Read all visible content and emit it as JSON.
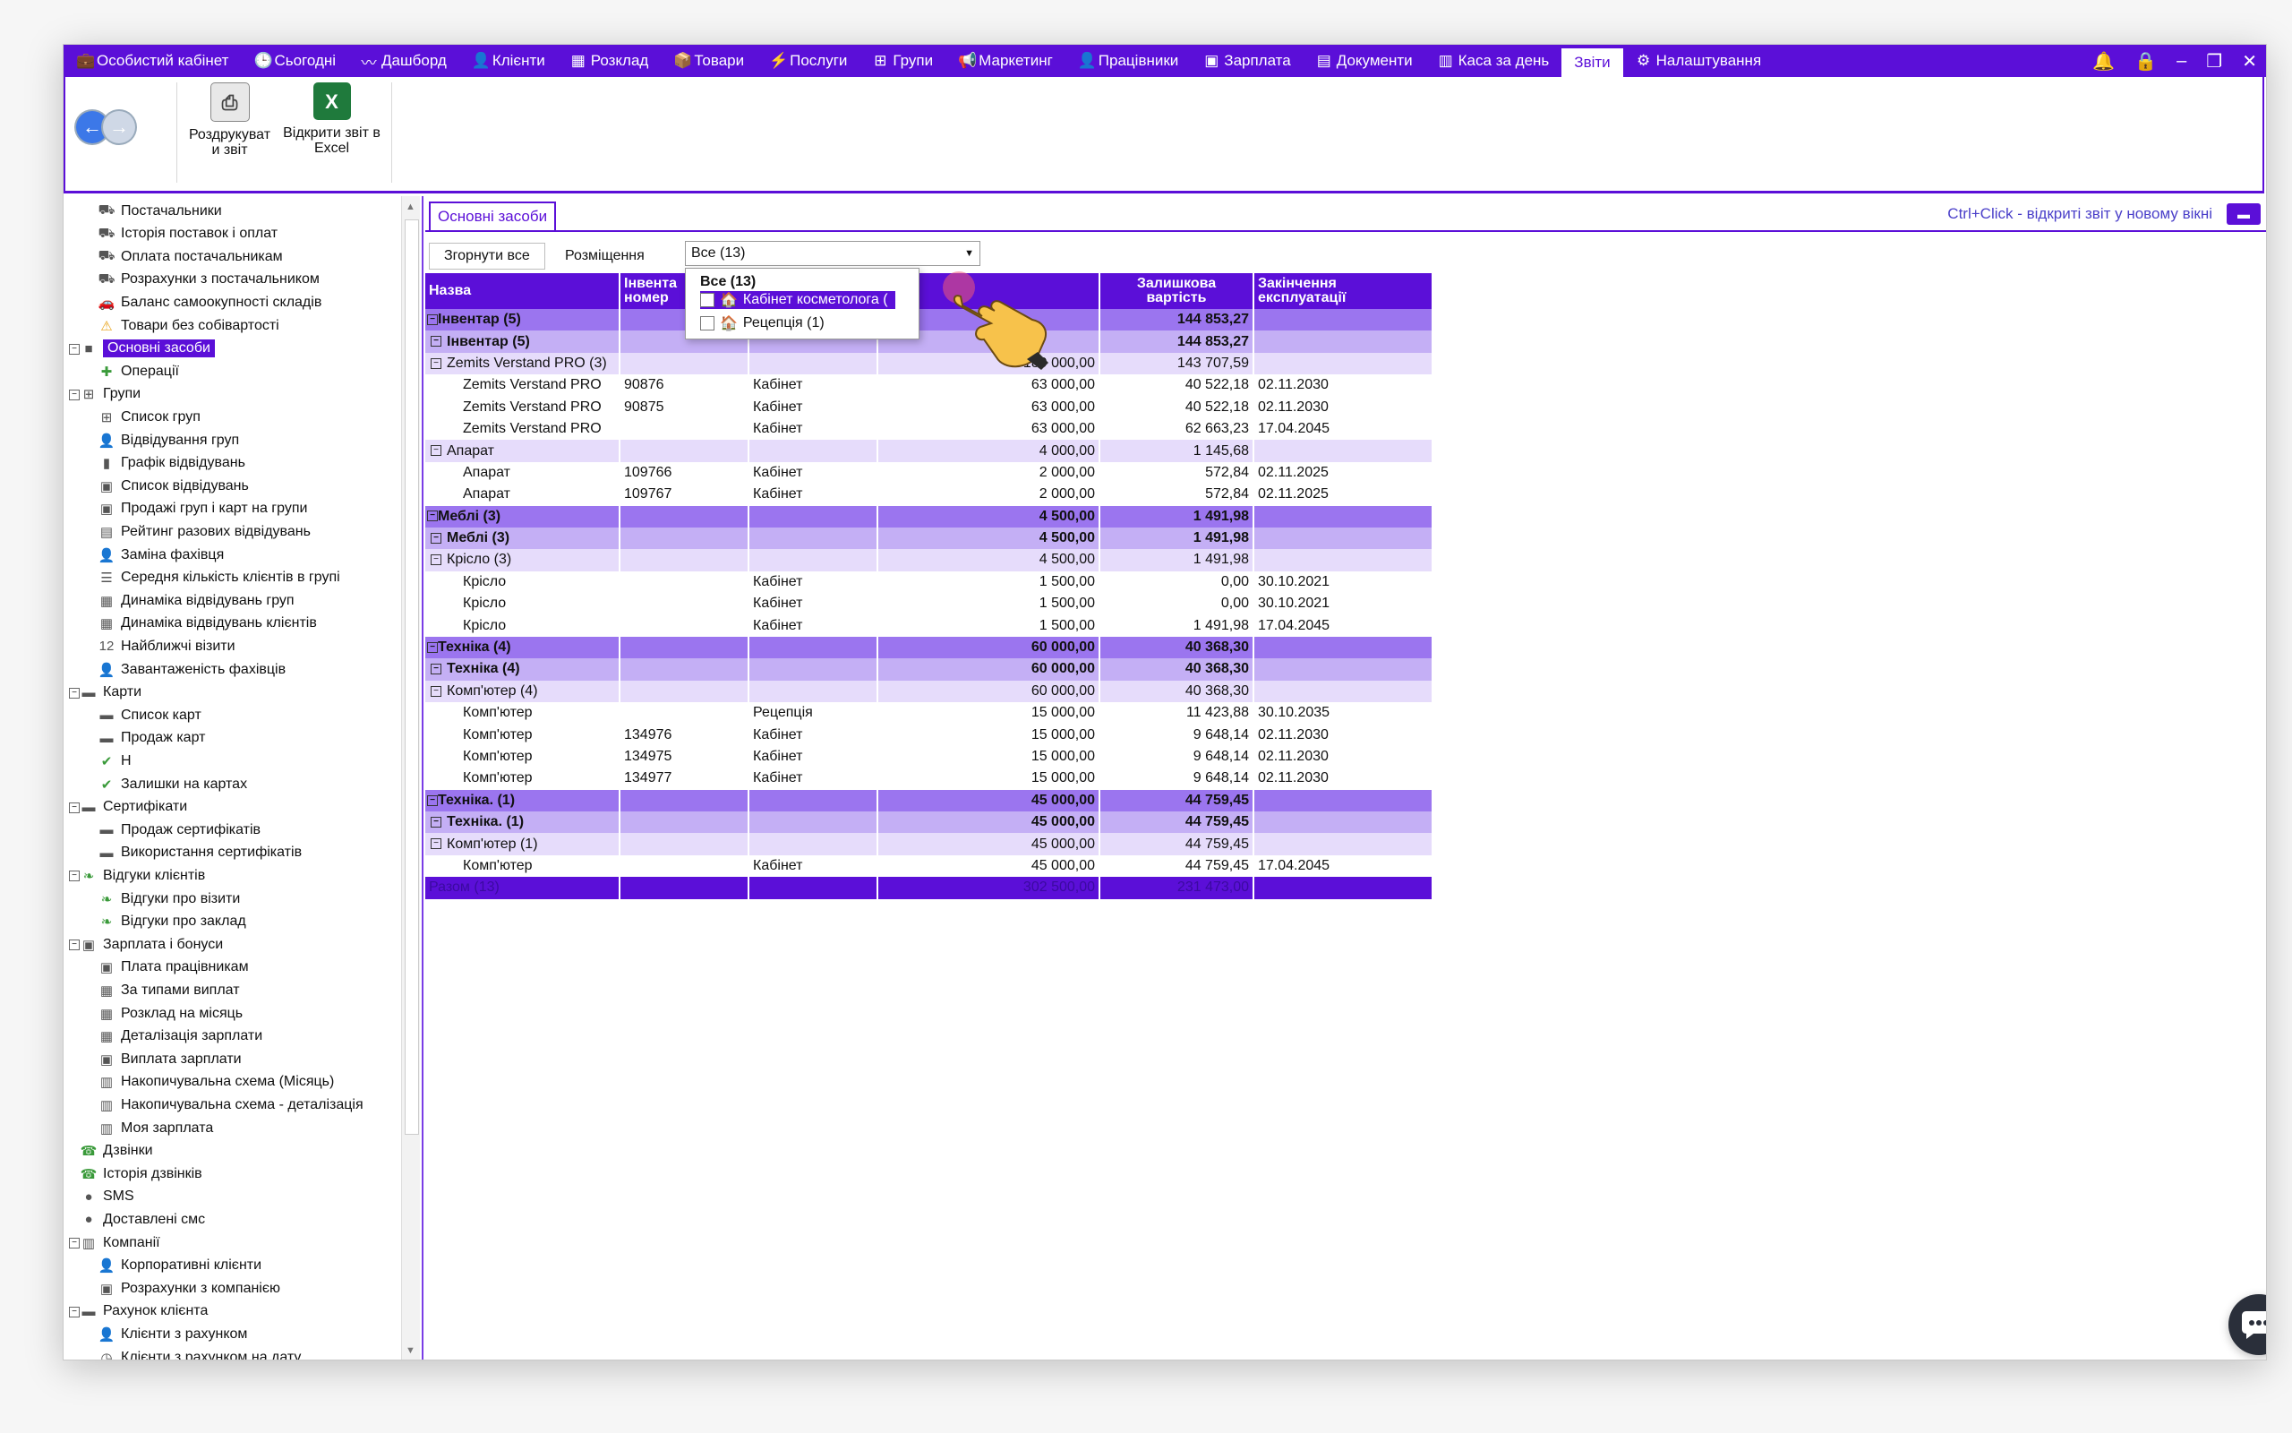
{
  "menu": [
    {
      "label": "Особистий кабінет",
      "icon": "briefcase-icon",
      "glyph": "💼"
    },
    {
      "label": "Сьогодні",
      "icon": "clock-icon",
      "glyph": "🕒"
    },
    {
      "label": "Дашборд",
      "icon": "pulse-icon",
      "glyph": "〰"
    },
    {
      "label": "Клієнти",
      "icon": "user-circle-icon",
      "glyph": "👤"
    },
    {
      "label": "Розклад",
      "icon": "calendar-icon",
      "glyph": "▦"
    },
    {
      "label": "Товари",
      "icon": "box-icon",
      "glyph": "📦"
    },
    {
      "label": "Послуги",
      "icon": "bolt-icon",
      "glyph": "⚡"
    },
    {
      "label": "Групи",
      "icon": "group-icon",
      "glyph": "⊞"
    },
    {
      "label": "Маркетинг",
      "icon": "megaphone-icon",
      "glyph": "📢"
    },
    {
      "label": "Працівники",
      "icon": "person-icon",
      "glyph": "👤"
    },
    {
      "label": "Зарплата",
      "icon": "money-icon",
      "glyph": "▣"
    },
    {
      "label": "Документи",
      "icon": "document-icon",
      "glyph": "▤"
    },
    {
      "label": "Каса за день",
      "icon": "calculator-icon",
      "glyph": "▥"
    },
    {
      "label": "Звіти",
      "icon": "",
      "glyph": ""
    },
    {
      "label": "Налаштування",
      "icon": "gear-icon",
      "glyph": "⚙"
    }
  ],
  "ribbon": {
    "print_label_1": "Роздрукуват",
    "print_label_2": "и звіт",
    "excel_label_1": "Відкрити звіт в",
    "excel_label_2": "Excel"
  },
  "tree": [
    {
      "label": "Постачальники",
      "level": 1,
      "icon": "suppliers-icon",
      "glyph": "⛟"
    },
    {
      "label": "Історія поставок і оплат",
      "level": 1,
      "icon": "suppliers-icon",
      "glyph": "⛟"
    },
    {
      "label": "Оплата постачальникам",
      "level": 1,
      "icon": "suppliers-icon",
      "glyph": "⛟"
    },
    {
      "label": "Розрахунки з постачальником",
      "level": 1,
      "icon": "suppliers-icon",
      "glyph": "⛟"
    },
    {
      "label": "Баланс самоокупності складів",
      "level": 1,
      "icon": "car-icon",
      "glyph": "🚗"
    },
    {
      "label": "Товари без собівартості",
      "level": 1,
      "icon": "warning-icon",
      "glyph": "⚠"
    },
    {
      "label": "Основні засоби",
      "level": 0,
      "icon": "assets-icon",
      "glyph": "■",
      "selected": true,
      "toggle": "−"
    },
    {
      "label": "Операції",
      "level": 1,
      "icon": "operations-icon",
      "glyph": "✚"
    },
    {
      "label": "Групи",
      "level": 0,
      "icon": "group-icon",
      "glyph": "⊞",
      "toggle": "−"
    },
    {
      "label": "Список груп",
      "level": 1,
      "icon": "group-icon",
      "glyph": "⊞"
    },
    {
      "label": "Відвідування груп",
      "level": 1,
      "icon": "person-icon",
      "glyph": "👤"
    },
    {
      "label": "Графік відвідувань",
      "level": 1,
      "icon": "bar-chart-icon",
      "glyph": "▮"
    },
    {
      "label": "Список відвідувань",
      "level": 1,
      "icon": "money-icon",
      "glyph": "▣"
    },
    {
      "label": "Продажі груп і карт на групи",
      "level": 1,
      "icon": "money-icon",
      "glyph": "▣"
    },
    {
      "label": "Рейтинг разових відвідувань",
      "level": 1,
      "icon": "rating-icon",
      "glyph": "▤"
    },
    {
      "label": "Заміна фахівця",
      "level": 1,
      "icon": "person-icon",
      "glyph": "👤"
    },
    {
      "label": "Середня кількість клієнтів в групі",
      "level": 1,
      "icon": "list-icon",
      "glyph": "☰"
    },
    {
      "label": "Динаміка відвідувань груп",
      "level": 1,
      "icon": "grid-icon",
      "glyph": "▦"
    },
    {
      "label": "Динаміка відвідувань клієнтів",
      "level": 1,
      "icon": "grid-icon",
      "glyph": "▦"
    },
    {
      "label": "Найближчі візити",
      "level": 1,
      "icon": "calendar-12-icon",
      "glyph": "12"
    },
    {
      "label": "Завантаженість фахівців",
      "level": 1,
      "icon": "person-icon",
      "glyph": "👤"
    },
    {
      "label": "Карти",
      "level": 0,
      "icon": "cards-icon",
      "glyph": "▬",
      "toggle": "−"
    },
    {
      "label": "Список карт",
      "level": 1,
      "icon": "cards-icon",
      "glyph": "▬"
    },
    {
      "label": "Продаж карт",
      "level": 1,
      "icon": "cards-icon",
      "glyph": "▬"
    },
    {
      "label": "Н",
      "level": 1,
      "icon": "check-card-icon",
      "glyph": "✔"
    },
    {
      "label": "Залишки на картах",
      "level": 1,
      "icon": "check-card-icon",
      "glyph": "✔"
    },
    {
      "label": "Сертифікати",
      "level": 0,
      "icon": "certificate-icon",
      "glyph": "▬",
      "toggle": "−"
    },
    {
      "label": "Продаж сертифікатів",
      "level": 1,
      "icon": "certificate-icon",
      "glyph": "▬"
    },
    {
      "label": "Використання сертифікатів",
      "level": 1,
      "icon": "certificate-icon",
      "glyph": "▬"
    },
    {
      "label": "Відгуки клієнтів",
      "level": 0,
      "icon": "feedback-icon",
      "glyph": "❧",
      "toggle": "−"
    },
    {
      "label": "Відгуки про візити",
      "level": 1,
      "icon": "feedback-icon",
      "glyph": "❧"
    },
    {
      "label": "Відгуки про заклад",
      "level": 1,
      "icon": "feedback-icon",
      "glyph": "❧"
    },
    {
      "label": "Зарплата і бонуси",
      "level": 0,
      "icon": "money-icon",
      "glyph": "▣",
      "toggle": "−"
    },
    {
      "label": "Плата працівникам",
      "level": 1,
      "icon": "money-icon",
      "glyph": "▣"
    },
    {
      "label": "За типами виплат",
      "level": 1,
      "icon": "grid-icon",
      "glyph": "▦"
    },
    {
      "label": "Розклад на місяць",
      "level": 1,
      "icon": "grid-icon",
      "glyph": "▦"
    },
    {
      "label": "Деталізація зарплати",
      "level": 1,
      "icon": "grid-icon",
      "glyph": "▦"
    },
    {
      "label": "Виплата зарплати",
      "level": 1,
      "icon": "money-icon",
      "glyph": "▣"
    },
    {
      "label": "Накопичувальна схема (Місяць)",
      "level": 1,
      "icon": "calculator-icon",
      "glyph": "▥"
    },
    {
      "label": "Накопичувальна схема - деталізація",
      "level": 1,
      "icon": "calculator-icon",
      "glyph": "▥"
    },
    {
      "label": "Моя зарплата",
      "level": 1,
      "icon": "calculator-icon",
      "glyph": "▥"
    },
    {
      "label": "Дзвінки",
      "level": 0,
      "icon": "phone-icon",
      "glyph": "☎"
    },
    {
      "label": "Історія дзвінків",
      "level": 0,
      "icon": "phone-icon",
      "glyph": "☎"
    },
    {
      "label": "SMS",
      "level": 0,
      "icon": "chat-icon",
      "glyph": "●"
    },
    {
      "label": "Доставлені смс",
      "level": 0,
      "icon": "chat-icon",
      "glyph": "●"
    },
    {
      "label": "Компанії",
      "level": 0,
      "icon": "building-icon",
      "glyph": "▥",
      "toggle": "−"
    },
    {
      "label": "Корпоративні клієнти",
      "level": 1,
      "icon": "person-icon",
      "glyph": "👤"
    },
    {
      "label": "Розрахунки з компанією",
      "level": 1,
      "icon": "money-icon",
      "glyph": "▣"
    },
    {
      "label": "Рахунок клієнта",
      "level": 0,
      "icon": "account-icon",
      "glyph": "▬",
      "toggle": "−"
    },
    {
      "label": "Клієнти з рахунком",
      "level": 1,
      "icon": "person-icon",
      "glyph": "👤"
    },
    {
      "label": "Клієнти з рахунком на дату",
      "level": 1,
      "icon": "clock-icon",
      "glyph": "◷"
    }
  ],
  "content": {
    "tab": "Основні засоби",
    "hint": "Ctrl+Click - відкриті звіт у новому вікні",
    "collapse_btn": "Згорнути все",
    "placement_label": "Розміщення",
    "placement_value": "Все (13)"
  },
  "dropdown": {
    "header": "Все (13)",
    "items": [
      {
        "label": "Кабінет косметолога (",
        "selected": true
      },
      {
        "label": "Рецепція (1)",
        "selected": false
      }
    ]
  },
  "table": {
    "headers": [
      {
        "line1": "Назва",
        "line2": ""
      },
      {
        "line1": "Інвента",
        "line2": "номер"
      },
      {
        "line1": "",
        "line2": ""
      },
      {
        "line1": "",
        "line2": ""
      },
      {
        "line1": "Залишкова",
        "line2": "вартість"
      },
      {
        "line1": "Закінчення",
        "line2": "експлуатації"
      }
    ],
    "rows": [
      {
        "lvl": "l1",
        "cells": [
          "Інвентар (5)",
          "",
          "",
          "",
          "144 853,27",
          ""
        ]
      },
      {
        "lvl": "l2",
        "cells": [
          "Інвентар (5)",
          "",
          "",
          "",
          "144 853,27",
          ""
        ]
      },
      {
        "lvl": "l3",
        "cells": [
          "Zemits Verstand PRO (3)",
          "",
          "",
          "189 000,00",
          "143 707,59",
          ""
        ]
      },
      {
        "lvl": "d",
        "cells": [
          "Zemits Verstand PRO",
          "90876",
          "Кабінет",
          "63 000,00",
          "40 522,18",
          "02.11.2030"
        ]
      },
      {
        "lvl": "d",
        "cells": [
          "Zemits Verstand PRO",
          "90875",
          "Кабінет",
          "63 000,00",
          "40 522,18",
          "02.11.2030"
        ]
      },
      {
        "lvl": "d",
        "cells": [
          "Zemits Verstand PRO",
          "",
          "Кабінет",
          "63 000,00",
          "62 663,23",
          "17.04.2045"
        ]
      },
      {
        "lvl": "l3",
        "cells": [
          "Апарат",
          "",
          "",
          "4 000,00",
          "1 145,68",
          ""
        ]
      },
      {
        "lvl": "d",
        "cells": [
          "Апарат",
          "109766",
          "Кабінет",
          "2 000,00",
          "572,84",
          "02.11.2025"
        ]
      },
      {
        "lvl": "d",
        "cells": [
          "Апарат",
          "109767",
          "Кабінет",
          "2 000,00",
          "572,84",
          "02.11.2025"
        ]
      },
      {
        "lvl": "l1",
        "cells": [
          "Меблі (3)",
          "",
          "",
          "4 500,00",
          "1 491,98",
          ""
        ]
      },
      {
        "lvl": "l2",
        "cells": [
          "Меблі (3)",
          "",
          "",
          "4 500,00",
          "1 491,98",
          ""
        ]
      },
      {
        "lvl": "l3",
        "cells": [
          "Крісло (3)",
          "",
          "",
          "4 500,00",
          "1 491,98",
          ""
        ]
      },
      {
        "lvl": "d",
        "cells": [
          "Крісло",
          "",
          "Кабінет",
          "1 500,00",
          "0,00",
          "30.10.2021"
        ]
      },
      {
        "lvl": "d",
        "cells": [
          "Крісло",
          "",
          "Кабінет",
          "1 500,00",
          "0,00",
          "30.10.2021"
        ]
      },
      {
        "lvl": "d",
        "cells": [
          "Крісло",
          "",
          "Кабінет",
          "1 500,00",
          "1 491,98",
          "17.04.2045"
        ]
      },
      {
        "lvl": "l1",
        "cells": [
          "Техніка (4)",
          "",
          "",
          "60 000,00",
          "40 368,30",
          ""
        ]
      },
      {
        "lvl": "l2",
        "cells": [
          "Техніка (4)",
          "",
          "",
          "60 000,00",
          "40 368,30",
          ""
        ]
      },
      {
        "lvl": "l3",
        "cells": [
          "Комп'ютер (4)",
          "",
          "",
          "60 000,00",
          "40 368,30",
          ""
        ]
      },
      {
        "lvl": "d",
        "cells": [
          "Комп'ютер",
          "",
          "Рецепція",
          "15 000,00",
          "11 423,88",
          "30.10.2035"
        ]
      },
      {
        "lvl": "d",
        "cells": [
          "Комп'ютер",
          "134976",
          "Кабінет",
          "15 000,00",
          "9 648,14",
          "02.11.2030"
        ]
      },
      {
        "lvl": "d",
        "cells": [
          "Комп'ютер",
          "134975",
          "Кабінет",
          "15 000,00",
          "9 648,14",
          "02.11.2030"
        ]
      },
      {
        "lvl": "d",
        "cells": [
          "Комп'ютер",
          "134977",
          "Кабінет",
          "15 000,00",
          "9 648,14",
          "02.11.2030"
        ]
      },
      {
        "lvl": "l1",
        "cells": [
          "Техніка. (1)",
          "",
          "",
          "45 000,00",
          "44 759,45",
          ""
        ]
      },
      {
        "lvl": "l2",
        "cells": [
          "Техніка. (1)",
          "",
          "",
          "45 000,00",
          "44 759,45",
          ""
        ]
      },
      {
        "lvl": "l3",
        "cells": [
          "Комп'ютер (1)",
          "",
          "",
          "45 000,00",
          "44 759,45",
          ""
        ]
      },
      {
        "lvl": "d",
        "cells": [
          "Комп'ютер",
          "",
          "Кабінет",
          "45 000,00",
          "44 759,45",
          "17.04.2045"
        ]
      },
      {
        "lvl": "total",
        "cells": [
          "Разом (13)",
          "",
          "",
          "302 500,00",
          "231 473,00",
          ""
        ]
      }
    ]
  },
  "colors": {
    "accent": "#5b0fd8",
    "group1": "#9b75ef",
    "group2": "#c4aff5",
    "group3": "#e6dcfb"
  }
}
